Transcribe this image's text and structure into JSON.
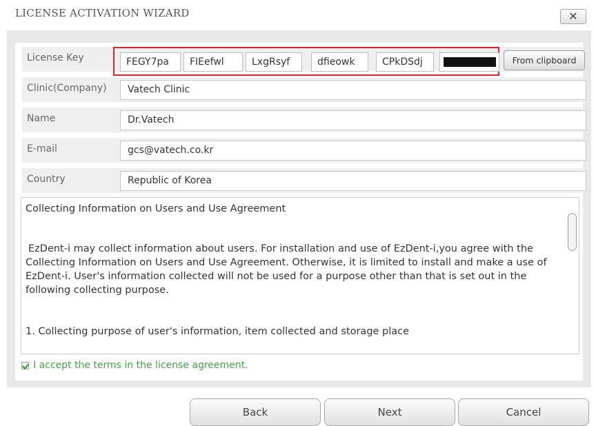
{
  "window": {
    "title": "LICENSE ACTIVATION WIZARD",
    "close_glyph": "✕"
  },
  "license": {
    "label": "License Key",
    "segments": [
      "FEGY7pa",
      "FIEefwl",
      "LxgRsyf",
      "dfieowk",
      "CPkDSdj"
    ],
    "masked_segment_note": "redacted",
    "clipboard_button": "From clipboard"
  },
  "fields": {
    "clinic": {
      "label": "Clinic(Company)",
      "value": "Vatech Clinic"
    },
    "name": {
      "label": "Name",
      "value": "Dr.Vatech"
    },
    "email": {
      "label": "E-mail",
      "value": "gcs@vatech.co.kr"
    },
    "country": {
      "label": "Country",
      "value": "Republic of Korea"
    }
  },
  "agreement": {
    "title": "Collecting Information on Users and Use Agreement",
    "body": "EzDent-i may collect information about users. For installation and use of EzDent-i,you agree with the Collecting Information on Users and Use Agreement. Otherwise, it is limited to install and make a use of EzDent-i. User's information collected will not be used for a purpose other than that is set out in the following collecting purpose.",
    "item1": "1. Collecting purpose of user's information, item collected and storage place",
    "accept_label": "I accept the terms in the license agreement.",
    "accepted": true
  },
  "buttons": {
    "back": "Back",
    "next": "Next",
    "cancel": "Cancel"
  },
  "colors": {
    "highlight_border": "#d8242b",
    "accept_text": "#3fa43f",
    "frame_bg": "#e8e8e8"
  }
}
